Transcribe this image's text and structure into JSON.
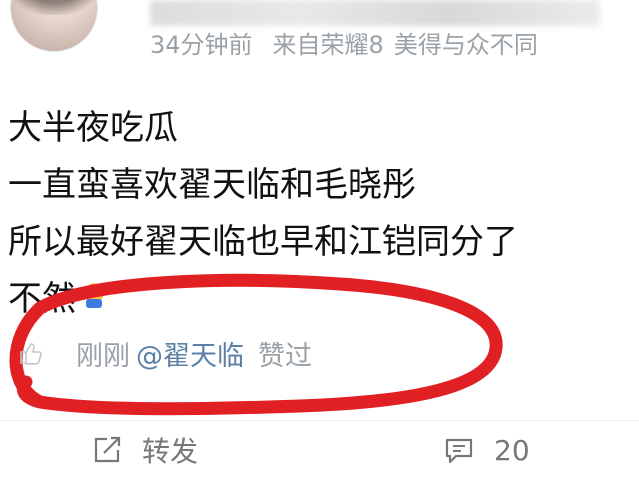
{
  "post": {
    "time": "34分钟前",
    "source_prefix": "来自荣耀8",
    "source_suffix": "美得与众不同",
    "content_lines": [
      "大半夜吃瓜",
      "一直蛮喜欢翟天临和毛晓彤",
      "所以最好翟天临也早和江铠同分了",
      "不然"
    ],
    "emoji": "face-with-hands-emoji"
  },
  "like_row": {
    "icon": "thumbs-up-icon",
    "time": "刚刚",
    "mention": "@翟天临",
    "suffix": "赞过"
  },
  "actions": {
    "repost_label": "转发",
    "comment_count": "20"
  },
  "annotation": {
    "color": "#e12024"
  }
}
